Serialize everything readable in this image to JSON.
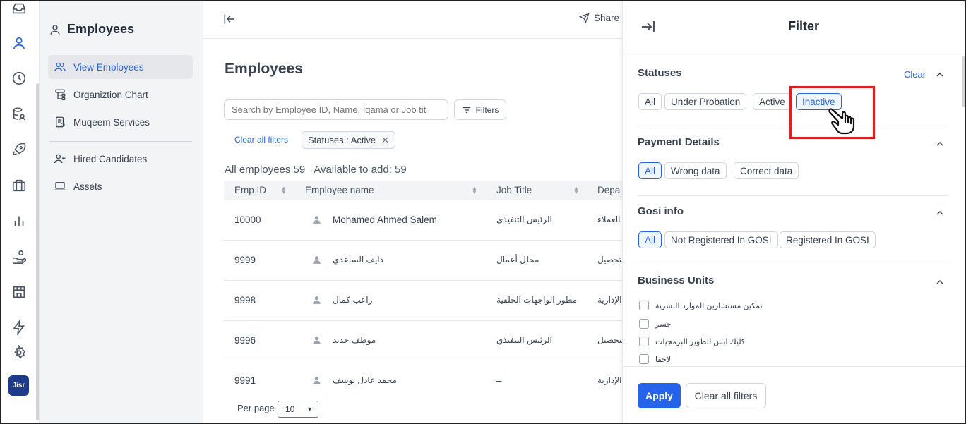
{
  "sidebar": {
    "title": "Employees",
    "items": [
      {
        "label": "View Employees"
      },
      {
        "label": "Organiztion Chart"
      },
      {
        "label": "Muqeem Services"
      },
      {
        "label": "Hired Candidates"
      },
      {
        "label": "Assets"
      }
    ]
  },
  "rail": {
    "logo_text": "Jisr",
    "icons": [
      "inbox-icon",
      "user-icon",
      "clock-icon",
      "database-user-icon",
      "rocket-icon",
      "briefcase-icon",
      "bar-chart-icon",
      "hand-coin-icon",
      "store-icon",
      "lightning-icon",
      "gear-icon"
    ]
  },
  "topbar": {
    "share_label": "Share"
  },
  "main": {
    "title": "Employees",
    "search_placeholder": "Search by Employee ID, Name, Iqama or Job tit",
    "filters_label": "Filters",
    "clear_filters_label": "Clear all filters",
    "active_chip": "Statuses : Active",
    "counts": {
      "all": "All employees 59",
      "available": "Available to add: 59"
    },
    "columns": [
      "Emp ID",
      "Employee name",
      "Job Title",
      "Depa"
    ],
    "rows": [
      {
        "id": "10000",
        "name": "Mohamed Ahmed Salem",
        "job": "الرئيس التنفيذي",
        "dept": "خدمة العملاء"
      },
      {
        "id": "9999",
        "name": "دايف الساعدي",
        "job": "محلل أعمال",
        "dept": "التحصيل"
      },
      {
        "id": "9998",
        "name": "راعب كمال",
        "job": "مطور الواجهات الخلفية",
        "dept": "الإدارية"
      },
      {
        "id": "9996",
        "name": "موظف جديد",
        "job": "الرئيس التنفيذي",
        "dept": "التحصيل"
      },
      {
        "id": "9991",
        "name": "محمد عادل يوسف",
        "job": "–",
        "dept": "الإدارية"
      }
    ],
    "per_page_label": "Per page",
    "per_page_value": "10"
  },
  "filter_panel": {
    "title": "Filter",
    "statuses": {
      "title": "Statuses",
      "clear_label": "Clear",
      "options": [
        "All",
        "Under Probation",
        "Active",
        "Inactive"
      ]
    },
    "payment": {
      "title": "Payment Details",
      "options": [
        "All",
        "Wrong data",
        "Correct data"
      ]
    },
    "gosi": {
      "title": "Gosi info",
      "options": [
        "All",
        "Not Registered In GOSI",
        "Registered In GOSI"
      ]
    },
    "business_units": {
      "title": "Business Units",
      "options": [
        "تمكين مستشارين الموارد البشرية",
        "جسر",
        "كليك ابس لتطوير البرمجيات",
        "لاحقا"
      ]
    },
    "apply_label": "Apply",
    "clear_all_label": "Clear all filters"
  },
  "colors": {
    "accent": "#2563eb",
    "highlight": "#e11d1d"
  }
}
